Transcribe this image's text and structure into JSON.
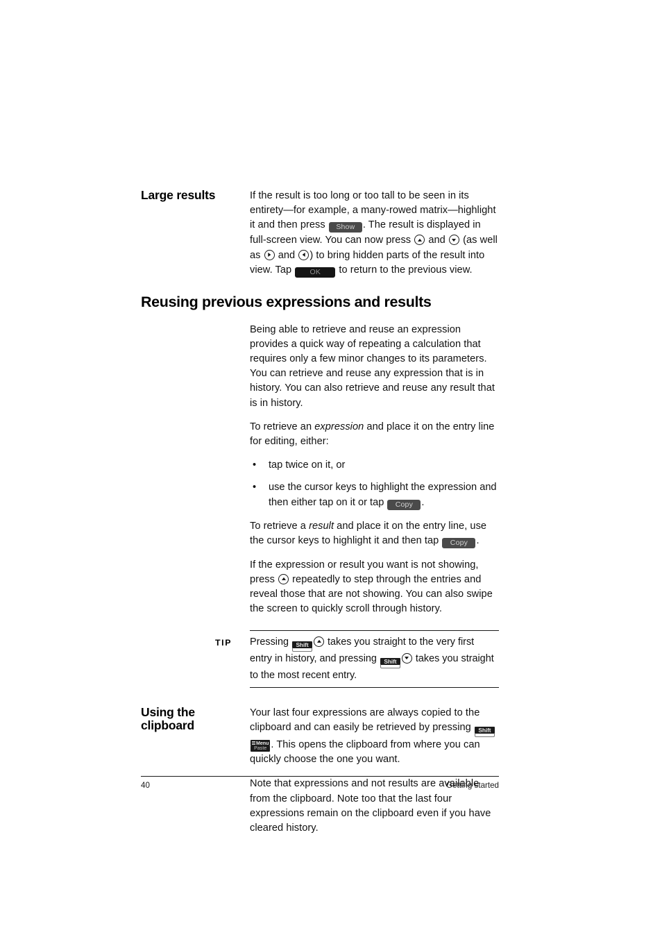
{
  "page": {
    "number": "40",
    "footer_section": "Getting started"
  },
  "sections": {
    "large_results": {
      "heading": "Large results",
      "text_part_1": "If the result is too long or too tall to be seen in its entirety—for example, a many-rowed matrix—highlight it and then press ",
      "key_show": "Show",
      "text_part_2": ". The result is displayed in full-screen view. You can now press ",
      "text_part_3": " and ",
      "text_part_4": " (as well as ",
      "text_part_5": " and ",
      "text_part_6": ") to bring hidden parts of the result into view. Tap ",
      "key_ok": "OK",
      "text_part_7": " to return to the previous view."
    },
    "reusing": {
      "title": "Reusing previous expressions and results",
      "para_1": "Being able to retrieve and reuse an expression provides a quick way of repeating a calculation that requires only a few minor changes to its parameters. You can retrieve and reuse any expression that is in history. You can also retrieve and reuse any result that is in history.",
      "para_2_a": "To retrieve an ",
      "para_2_italic": "expression",
      "para_2_b": " and place it on the entry line for editing, either:",
      "bullet_marker": "•",
      "bullet_1": "tap twice on it, or",
      "bullet_2_a": "use the cursor keys to highlight the expression and then either tap on it or tap ",
      "bullet_2_key": "Copy",
      "bullet_2_b": ".",
      "para_3_a": "To retrieve a ",
      "para_3_italic": "result",
      "para_3_b": " and place it on the entry line, use the cursor keys to highlight it and then tap ",
      "para_3_key": "Copy",
      "para_3_c": ".",
      "para_4_a": "If the expression or result you want is not showing, press ",
      "para_4_b": " repeatedly to step through the entries and reveal those that are not showing. You can also swipe the screen to quickly scroll through history."
    },
    "tip": {
      "label": "TIP",
      "text_a": "Pressing ",
      "key_shift_1": "Shift",
      "text_b": " takes you straight to the very first entry in history, and pressing ",
      "key_shift_2": "Shift",
      "text_c": " takes you straight to the most recent entry."
    },
    "clipboard": {
      "heading": "Using the clipboard",
      "para_1_a": "Your last four expressions are always copied to the clipboard and can easily be retrieved by pressing ",
      "key_shift": "Shift",
      "key_menu": "Menu",
      "key_paste": "Paste",
      "para_1_b": ". This opens the clipboard from where you can quickly choose the one you want.",
      "para_2": "Note that expressions and not results are available from the clipboard. Note too that the last four expressions remain on the clipboard even if you have cleared history."
    }
  },
  "icons": {
    "cursor_up": "cursor-up-key-icon",
    "cursor_down": "cursor-down-key-icon",
    "cursor_left": "cursor-left-key-icon",
    "cursor_right": "cursor-right-key-icon"
  },
  "colors": {
    "text": "#111111",
    "rule": "#1a1a1a",
    "button_gray": "#4a4a4a",
    "button_black": "#151515",
    "key_black": "#1b1b1b"
  }
}
